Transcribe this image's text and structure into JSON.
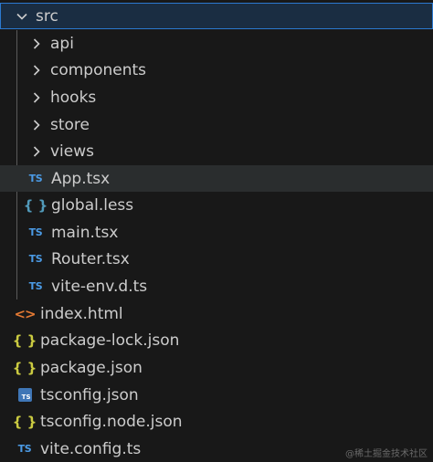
{
  "explorer": {
    "root_folder": {
      "label": "src",
      "expanded": true,
      "icon": "chevron-down-icon"
    },
    "sub_folders": [
      {
        "label": "api",
        "icon": "chevron-right-icon"
      },
      {
        "label": "components",
        "icon": "chevron-right-icon"
      },
      {
        "label": "hooks",
        "icon": "chevron-right-icon"
      },
      {
        "label": "store",
        "icon": "chevron-right-icon"
      },
      {
        "label": "views",
        "icon": "chevron-right-icon"
      }
    ],
    "src_files": [
      {
        "label": "App.tsx",
        "icon_text": "TS",
        "icon": "typescript-icon"
      },
      {
        "label": "global.less",
        "icon_text": "{ }",
        "icon": "less-icon"
      },
      {
        "label": "main.tsx",
        "icon_text": "TS",
        "icon": "typescript-icon"
      },
      {
        "label": "Router.tsx",
        "icon_text": "TS",
        "icon": "typescript-icon"
      },
      {
        "label": "vite-env.d.ts",
        "icon_text": "TS",
        "icon": "typescript-icon"
      }
    ],
    "root_files": [
      {
        "label": "index.html",
        "icon_text": "<>",
        "icon": "html-icon"
      },
      {
        "label": "package-lock.json",
        "icon_text": "{ }",
        "icon": "json-icon"
      },
      {
        "label": "package.json",
        "icon_text": "{ }",
        "icon": "json-icon"
      },
      {
        "label": "tsconfig.json",
        "icon_text": "TS",
        "icon": "tsconfig-icon"
      },
      {
        "label": "tsconfig.node.json",
        "icon_text": "{ }",
        "icon": "json-icon"
      },
      {
        "label": "vite.config.ts",
        "icon_text": "TS",
        "icon": "typescript-icon"
      }
    ],
    "colors": {
      "background": "#181818",
      "selection_border": "#2b79d0",
      "ts_blue": "#4b9be6",
      "json_yellow": "#cbcb41",
      "less_blue": "#519aba",
      "html_orange": "#e37933"
    }
  },
  "watermark": "@稀土掘金技术社区"
}
